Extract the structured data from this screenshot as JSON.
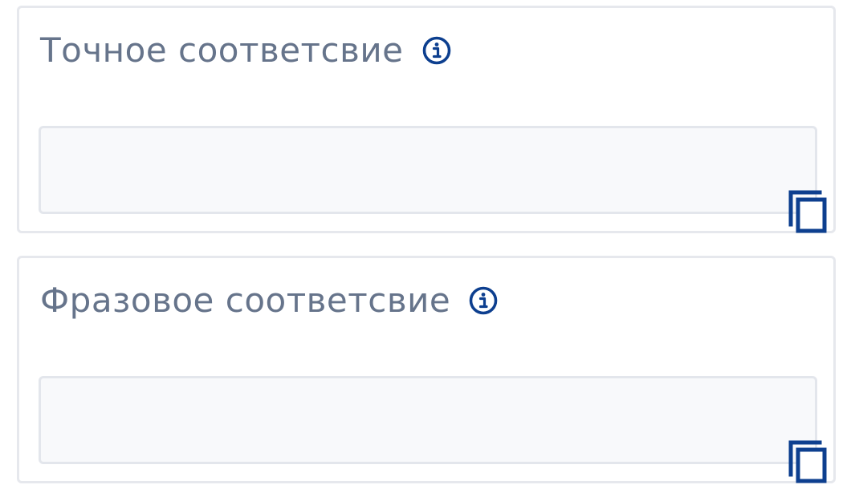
{
  "exact_match": {
    "title": "Точное соответсвие",
    "info_icon": "info-icon",
    "value": "",
    "copy_icon": "copy-icon"
  },
  "phrase_match": {
    "title": "Фразовое соответсвие",
    "info_icon": "info-icon",
    "value": "",
    "copy_icon": "copy-icon"
  },
  "colors": {
    "title_text": "#66748b",
    "icon_blue": "#0d3f8f",
    "field_background": "#f8f9fb",
    "border": "#e6e8ed"
  }
}
